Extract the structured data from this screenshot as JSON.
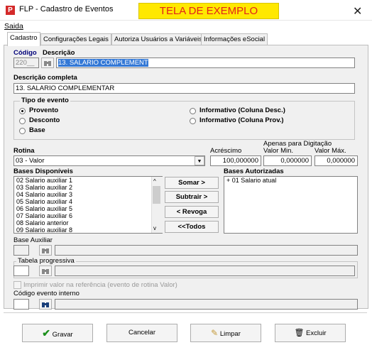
{
  "window": {
    "title": "FLP - Cadastro de Eventos",
    "banner": "TELA DE EXEMPLO",
    "app_icon": "P",
    "close": "✕"
  },
  "menu": {
    "items": [
      {
        "label": "Saida"
      }
    ]
  },
  "tabs": [
    {
      "label": "Cadastro",
      "active": true
    },
    {
      "label": "Configurações Legais"
    },
    {
      "label": "Autoriza Usuários a Variáveis"
    },
    {
      "label": "Informações eSocial"
    }
  ],
  "form": {
    "codigo_label": "Código",
    "descricao_label": "Descrição",
    "codigo_value": "220__",
    "descricao_value": "13. SALARIO COMPLEMENT",
    "descricao_completa_label": "Descrição completa",
    "descricao_completa_value": "13. SALARIO COMPLEMENTAR",
    "tipo_evento": {
      "title": "Tipo de evento",
      "options": [
        {
          "label": "Provento",
          "selected": true
        },
        {
          "label": "Desconto"
        },
        {
          "label": "Base"
        },
        {
          "label": "Informativo (Coluna Desc.)"
        },
        {
          "label": "Informativo (Coluna Prov.)"
        }
      ]
    },
    "rotina_label": "Rotina",
    "rotina_value": "03 - Valor",
    "acrescimo_label": "Acréscimo",
    "acrescimo_value": "100,000000",
    "apenas_label": "Apenas para Digitação",
    "valor_min_label": "Valor Min.",
    "valor_min_value": "0,000000",
    "valor_max_label": "Valor Máx.",
    "valor_max_value": "0,000000",
    "bases_disponiveis_label": "Bases Disponíveis",
    "bases_disponiveis": [
      "02 Salario auxiliar 1",
      "03 Salario auxiliar 2",
      "04 Salario auxiliar 3",
      "05 Salario auxiliar 4",
      "06 Salario auxiliar 5",
      "07 Salario auxiliar 6",
      "08 Salario anterior",
      "09 Salario auxiliar 8"
    ],
    "bases_autorizadas_label": "Bases Autorizadas",
    "bases_autorizadas": [
      "+ 01 Salario atual"
    ],
    "btn_somar": "Somar >",
    "btn_subtrair": "Subtrair >",
    "btn_revoga": "< Revoga",
    "btn_todos": "<<Todos",
    "base_auxiliar_label": "Base Auxiliar",
    "tabela_progressiva_label": "Tabela progressiva",
    "imprimir_label": "Imprimir valor na referência (evento de rotina Valor)",
    "codigo_evento_interno_label": "Código evento interno"
  },
  "footer": {
    "gravar": "Gravar",
    "cancelar": "Cancelar",
    "limpar": "Limpar",
    "excluir": "Excluir"
  },
  "colors": {
    "banner_bg": "#ffe800",
    "banner_text": "#e2231a",
    "selection": "#3378d6",
    "label_blue": "#00007a"
  }
}
